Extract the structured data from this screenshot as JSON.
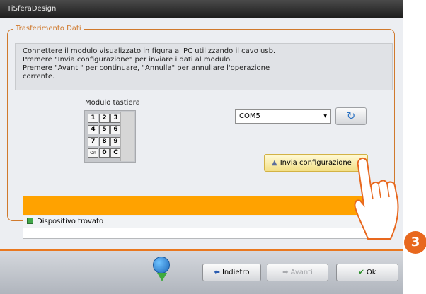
{
  "window": {
    "title": "TiSferaDesign"
  },
  "group": {
    "title": "Trasferimento Dati"
  },
  "info": {
    "lines": [
      "Connettere il modulo visualizzato in figura al PC utilizzando il cavo usb.",
      "Premere \"Invia configurazione\" per inviare i dati al modulo.",
      "Premere \"Avanti\" per continuare, \"Annulla\" per annullare l'operazione",
      "corrente."
    ]
  },
  "device": {
    "title": "Modulo tastiera",
    "keys": [
      "1",
      "2",
      "3",
      "4",
      "5",
      "6",
      "7",
      "8",
      "9",
      "On",
      "0",
      "C"
    ]
  },
  "port": {
    "selected": "COM5",
    "refresh_icon": "refresh-icon"
  },
  "send_button": {
    "label": "Invia configurazione",
    "icon": "upload-icon"
  },
  "progress": {
    "value_percent": 100,
    "color": "#ffa200"
  },
  "log": {
    "entries": [
      "Dispositivo trovato"
    ],
    "status_color": "#43a84a"
  },
  "footer": {
    "back_label": "Indietro",
    "next_label": "Avanti",
    "ok_label": "Ok",
    "next_disabled": true
  },
  "callout": {
    "step": "3"
  },
  "colors": {
    "accent": "#e9781f",
    "titlebar": "#2a2a2a"
  }
}
